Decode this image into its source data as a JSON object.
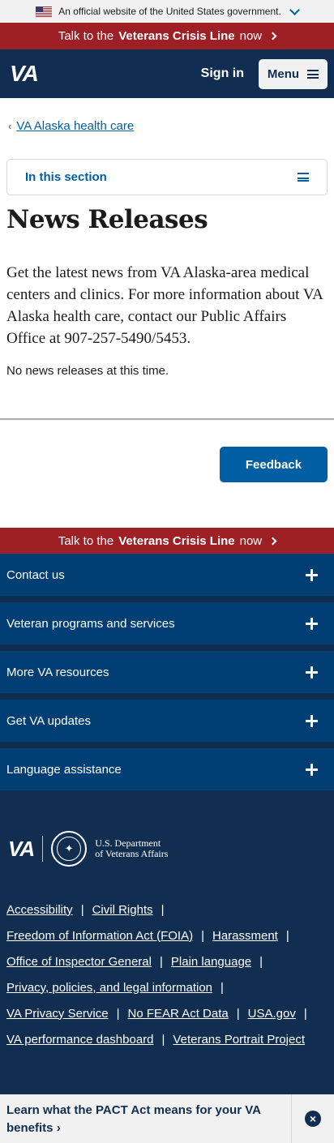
{
  "gov_banner": {
    "text": "An official website of the United States government."
  },
  "crisis_line": {
    "prefix": "Talk to the",
    "name": "Veterans Crisis Line",
    "suffix": "now"
  },
  "header": {
    "logo": "VA",
    "sign_in": "Sign in",
    "menu": "Menu"
  },
  "breadcrumb": {
    "link": "VA Alaska health care"
  },
  "section_nav": {
    "label": "In this section"
  },
  "main": {
    "title": "News Releases",
    "intro": "Get the latest news from VA Alaska-area medical centers and clinics. For more information about VA Alaska health care, contact our Public Affairs Office at 907-257-5490/5453.",
    "empty": "No news releases at this time."
  },
  "feedback": {
    "label": "Feedback"
  },
  "footer": {
    "accordion": [
      "Contact us",
      "Veteran programs and services",
      "More VA resources",
      "Get VA updates",
      "Language assistance"
    ],
    "brand": {
      "va": "VA",
      "dept_line1": "U.S. Department",
      "dept_line2": "of Veterans Affairs"
    },
    "links": [
      [
        "Accessibility",
        "Civil Rights"
      ],
      [
        "Freedom of Information Act (FOIA)",
        "Harassment"
      ],
      [
        "Office of Inspector General",
        "Plain language"
      ],
      [
        "Privacy, policies, and legal information"
      ],
      [
        "VA Privacy Service",
        "No FEAR Act Data",
        "USA.gov"
      ],
      [
        "VA performance dashboard",
        "Veterans Portrait Project"
      ]
    ]
  },
  "pact_banner": {
    "text": "Learn what the PACT Act means for your VA benefits",
    "arrow": "›",
    "close": "×"
  }
}
